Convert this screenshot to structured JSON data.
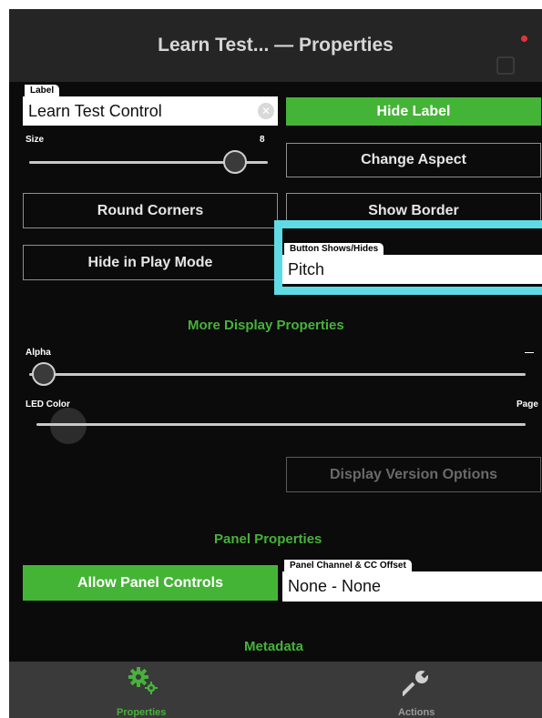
{
  "window": {
    "title": "Learn Test... — Properties"
  },
  "label_field": {
    "tag": "Label",
    "value": "Learn Test Control"
  },
  "size": {
    "label": "Size",
    "value": "8"
  },
  "buttons": {
    "hide_label": "Hide Label",
    "change_aspect": "Change Aspect",
    "round_corners": "Round Corners",
    "show_border": "Show Border",
    "hide_in_play_mode": "Hide in Play Mode",
    "display_version_options": "Display Version Options",
    "allow_panel_controls": "Allow Panel Controls"
  },
  "button_shows_hides": {
    "tag": "Button Shows/Hides",
    "value": "Pitch"
  },
  "sections": {
    "more_display": "More Display Properties",
    "panel": "Panel Properties",
    "metadata": "Metadata"
  },
  "alpha": {
    "label": "Alpha",
    "right_label": "—"
  },
  "led_color": {
    "label": "LED Color",
    "right_label": "Page"
  },
  "panel_channel": {
    "tag": "Panel Channel & CC Offset",
    "value": "None - None"
  },
  "tabs": [
    {
      "label": "Properties",
      "icon": "gear-icon",
      "active": true
    },
    {
      "label": "Actions",
      "icon": "wrench-icon",
      "active": false
    }
  ],
  "colors": {
    "accent_green": "#44b436",
    "highlight_cyan": "#5fdbe6",
    "background": "#0b0b0b"
  }
}
